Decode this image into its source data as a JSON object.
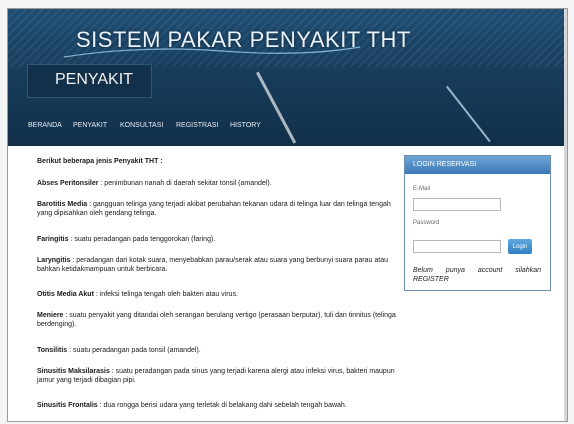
{
  "header": {
    "site_title": "SISTEM PAKAR PENYAKIT THT",
    "page_title": "PENYAKIT"
  },
  "nav": {
    "items": [
      "BERANDA",
      "PENYAKIT",
      "KONSULTASI",
      "REGISTRASI",
      "HISTORY"
    ]
  },
  "content": {
    "intro": "Berikut beberapa jenis Penyakit THT :",
    "diseases": [
      {
        "name": "Abses Peritonsiler",
        "desc": " : penimbunan nanah di daerah sekitar tonsil (amandel)."
      },
      {
        "name": "Barotitis Media",
        "desc": " : gangguan telinga yang terjadi akibat perubahan tekanan udara di telinga luar dan telinga tengah yang dipisahkan oleh gendang telinga."
      },
      {
        "name": "Faringitis",
        "desc": " : suatu peradangan pada tenggorokan (faring)."
      },
      {
        "name": "Laryngitis",
        "desc": " : peradangan dari kotak suara, menyebabkan parau/serak atau suara yang berbunyi suara parau atau bahkan ketidakmampuan untuk berbicara."
      },
      {
        "name": "Otitis Media Akut",
        "desc": " : infeksi telinga tengah oleh bakteri atau virus."
      },
      {
        "name": "Meniere",
        "desc": " : suatu penyakit yang ditandai oleh serangan berulang vertigo (perasaan berputar), tuli dan tinnitus (telinga berdenging)."
      },
      {
        "name": "Tonsilitis",
        "desc": " : suatu peradangan pada tonsil (amandel)."
      },
      {
        "name": "Sinusitis Maksilarasis",
        "desc": " : suatu peradangan pada sinus yang terjadi karena alergi atau infeksi virus, bakteri maupun jamur yang terjadi dibagian pipi."
      },
      {
        "name": "Sinusitis Frontalis",
        "desc": " : dua rongga berisi udara yang terletak di belakang dahi sebelah tengah bawah."
      }
    ]
  },
  "sidebar": {
    "title": "LOGIN RESERVASI",
    "email_label": "E-Mail",
    "email_value": "",
    "password_label": "Password",
    "password_value": "",
    "login_label": "Login",
    "note": "Belum punya account silahkan REGISTER"
  },
  "colors": {
    "header_bg": "#173d5c",
    "accent": "#3a77b4"
  }
}
